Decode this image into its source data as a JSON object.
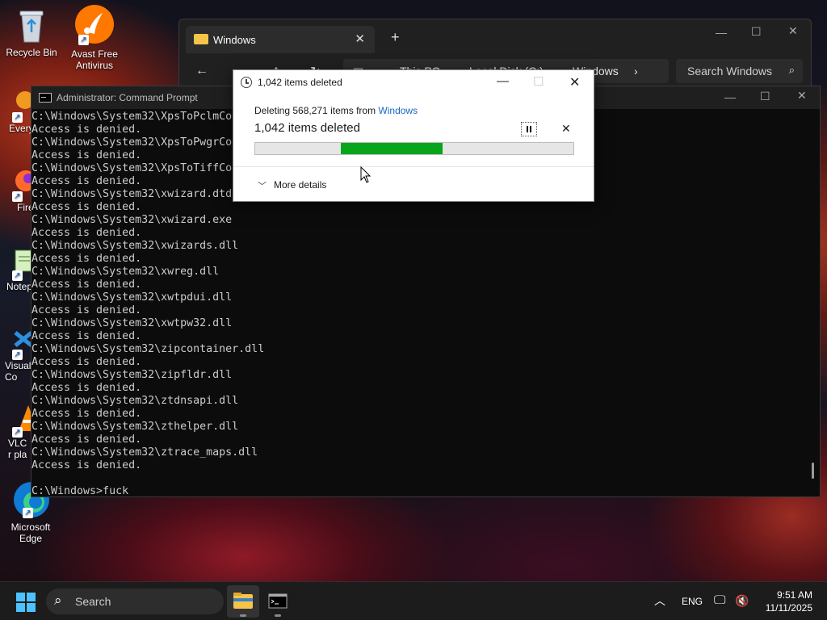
{
  "desktop": {
    "icons": [
      {
        "label": "Recycle Bin"
      },
      {
        "label": "Avast Free Antivirus"
      },
      {
        "label": "Every"
      },
      {
        "label": "Fire"
      },
      {
        "label": "Notep"
      },
      {
        "label": "Visual Co"
      },
      {
        "label": "VLC r pla"
      },
      {
        "label": "Microsoft Edge"
      }
    ]
  },
  "explorer": {
    "tab_title": "Windows",
    "breadcrumb": [
      "This PC",
      "Local Disk (C:)",
      "Windows"
    ],
    "search_placeholder": "Search Windows"
  },
  "cmd": {
    "title": "Administrator: Command Prompt",
    "lines": [
      "C:\\Windows\\System32\\XpsToPclmConverter.dll",
      "Access is denied.",
      "C:\\Windows\\System32\\XpsToPwgrConverter.dll",
      "Access is denied.",
      "C:\\Windows\\System32\\XpsToTiffConverter.dll",
      "Access is denied.",
      "C:\\Windows\\System32\\xwizard.dtd",
      "Access is denied.",
      "C:\\Windows\\System32\\xwizard.exe",
      "Access is denied.",
      "C:\\Windows\\System32\\xwizards.dll",
      "Access is denied.",
      "C:\\Windows\\System32\\xwreg.dll",
      "Access is denied.",
      "C:\\Windows\\System32\\xwtpdui.dll",
      "Access is denied.",
      "C:\\Windows\\System32\\xwtpw32.dll",
      "Access is denied.",
      "C:\\Windows\\System32\\zipcontainer.dll",
      "Access is denied.",
      "C:\\Windows\\System32\\zipfldr.dll",
      "Access is denied.",
      "C:\\Windows\\System32\\ztdnsapi.dll",
      "Access is denied.",
      "C:\\Windows\\System32\\zthelper.dll",
      "Access is denied.",
      "C:\\Windows\\System32\\ztrace_maps.dll",
      "Access is denied.",
      "",
      "C:\\Windows>fuck"
    ]
  },
  "dialog": {
    "title": "1,042 items deleted",
    "deleting_prefix": "Deleting 568,271 items from ",
    "deleting_target": "Windows",
    "status": "1,042 items deleted",
    "progress": {
      "start": 0.27,
      "end": 0.59
    },
    "progress_color": "#06a51b",
    "more_details": "More details"
  },
  "taskbar": {
    "search_placeholder": "Search",
    "language": "ENG",
    "time": "9:51 AM",
    "date": "11/11/2025"
  }
}
